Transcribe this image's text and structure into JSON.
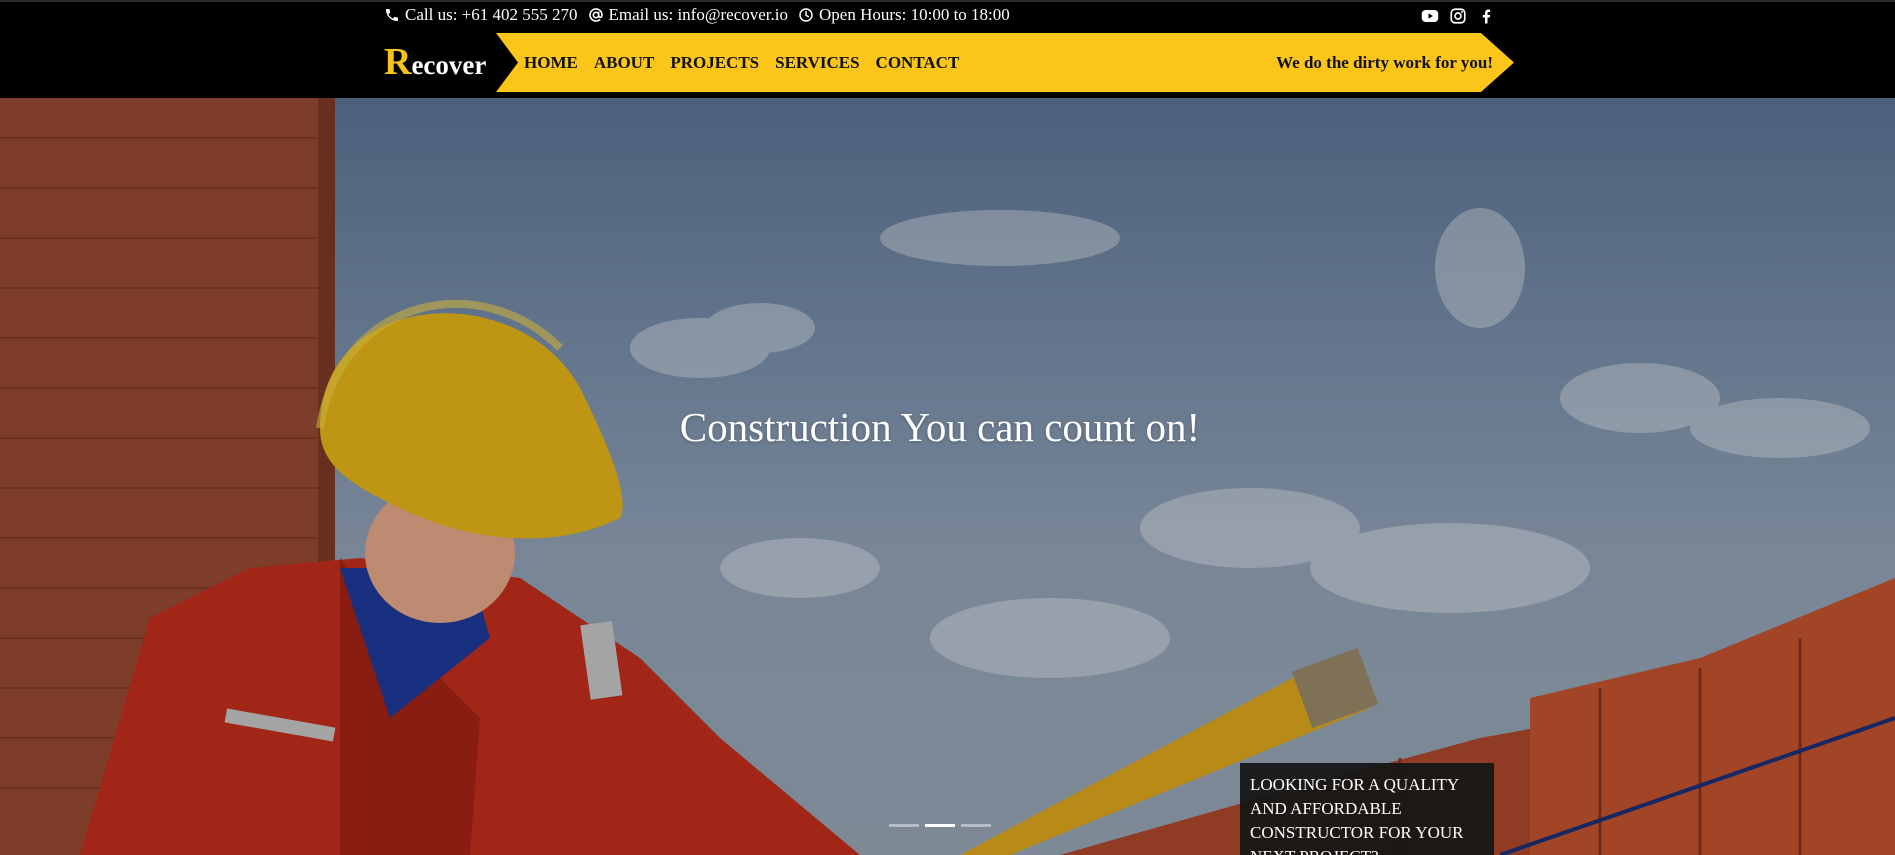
{
  "topbar": {
    "phone": {
      "icon": "phone-icon",
      "text": "Call us: +61 402 555 270"
    },
    "email": {
      "icon": "at-icon",
      "text": "Email us: info@recover.io"
    },
    "hours": {
      "icon": "clock-icon",
      "text": "Open Hours: 10:00 to 18:00"
    },
    "social": [
      "youtube-icon",
      "instagram-icon",
      "facebook-icon"
    ]
  },
  "nav": {
    "logo_first": "R",
    "logo_rest": "ecover",
    "links": [
      "HOME",
      "ABOUT",
      "PROJECTS",
      "SERVICES",
      "CONTACT"
    ],
    "tagline": "We do the dirty work for you!"
  },
  "hero": {
    "headline": "Construction You can count on!",
    "slider": {
      "count": 3,
      "active": 2
    },
    "cta_text": "LOOKING FOR A QUALITY AND AFFORDABLE CONSTRUCTOR FOR YOUR NEXT PROJECT?"
  },
  "colors": {
    "accent_yellow": "#fbc519",
    "background": "#000000",
    "text_light": "#ffffff"
  }
}
